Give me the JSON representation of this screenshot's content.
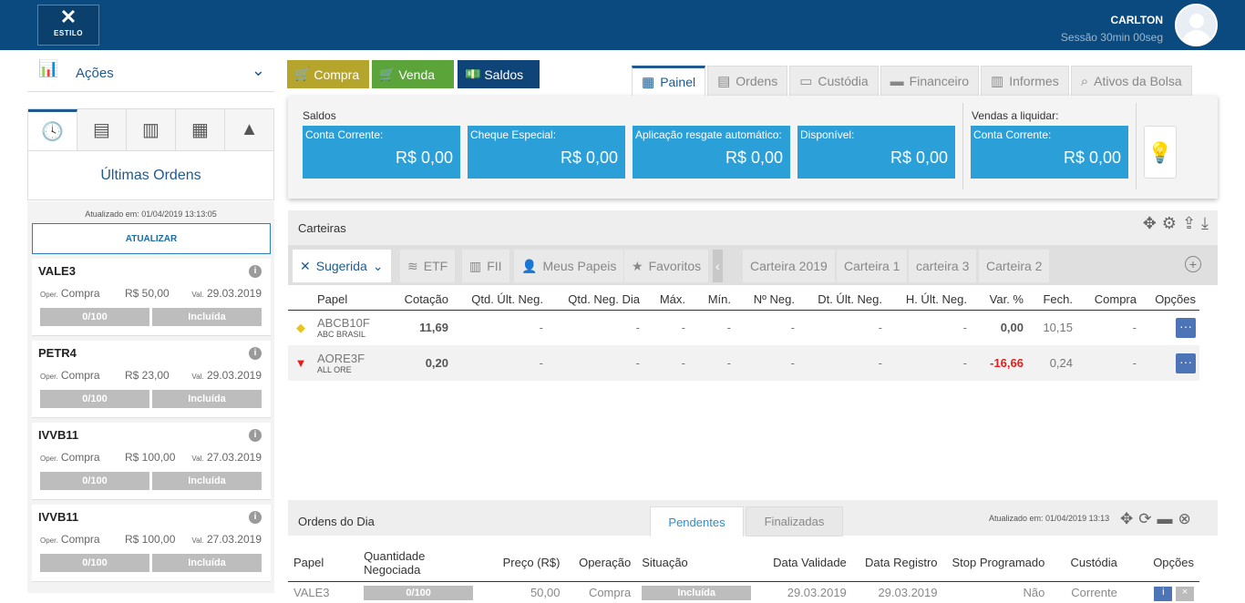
{
  "header": {
    "logo_text": "ESTILO",
    "user_name": "CARLTON",
    "session": "Sessão 30min 00seg"
  },
  "left": {
    "market_select": "Ações",
    "panel_title": "Últimas Ordens",
    "updated": "Atualizado em: 01/04/2019 13:13:05",
    "refresh_label": "ATUALIZAR",
    "orders": [
      {
        "ticker": "VALE3",
        "op_prefix": "Oper.",
        "op": "Compra",
        "price": "R$ 50,00",
        "val_prefix": "Val.",
        "val": "29.03.2019",
        "qty": "0/100",
        "status": "Incluída"
      },
      {
        "ticker": "PETR4",
        "op_prefix": "Oper.",
        "op": "Compra",
        "price": "R$ 23,00",
        "val_prefix": "Val.",
        "val": "29.03.2019",
        "qty": "0/100",
        "status": "Incluída"
      },
      {
        "ticker": "IVVB11",
        "op_prefix": "Oper.",
        "op": "Compra",
        "price": "R$ 100,00",
        "val_prefix": "Val.",
        "val": "27.03.2019",
        "qty": "0/100",
        "status": "Incluída"
      },
      {
        "ticker": "IVVB11",
        "op_prefix": "Oper.",
        "op": "Compra",
        "price": "R$ 100,00",
        "val_prefix": "Val.",
        "val": "27.03.2019",
        "qty": "0/100",
        "status": "Incluída"
      }
    ]
  },
  "actions": {
    "compra": "Compra",
    "venda": "Venda",
    "saldos": "Saldos"
  },
  "tabs": [
    "Painel",
    "Ordens",
    "Custódia",
    "Financeiro",
    "Informes",
    "Ativos da Bolsa"
  ],
  "saldos": {
    "title": "Saldos",
    "title2": "Vendas a liquidar:",
    "boxes": [
      {
        "label": "Conta Corrente:",
        "value": "R$ 0,00"
      },
      {
        "label": "Cheque Especial:",
        "value": "R$ 0,00"
      },
      {
        "label": "Aplicação resgate automático:",
        "value": "R$ 0,00"
      },
      {
        "label": "Disponível:",
        "value": "R$ 0,00"
      },
      {
        "label": "Conta Corrente:",
        "value": "R$ 0,00"
      }
    ]
  },
  "carteiras": {
    "title": "Carteiras",
    "tabs": [
      "Sugerida",
      "ETF",
      "FII",
      "Meus Papeis",
      "Favoritos",
      "Carteira 2019",
      "Carteira 1",
      "carteira 3",
      "Carteira 2"
    ],
    "columns": [
      "Papel",
      "Cotação",
      "Qtd. Últ. Neg.",
      "Qtd. Neg. Dia",
      "Máx.",
      "Mín.",
      "Nº Neg.",
      "Dt. Últ. Neg.",
      "H. Últ. Neg.",
      "Var. %",
      "Fech.",
      "Compra",
      "Opções"
    ],
    "rows": [
      {
        "ticker": "ABCB10F",
        "name": "ABC BRASIL",
        "cot": "11,69",
        "qul": "-",
        "qnd": "-",
        "max": "-",
        "min": "-",
        "nneg": "-",
        "dt": "-",
        "h": "-",
        "var": "0,00",
        "fech": "10,15",
        "compra": "-",
        "opts": "···",
        "trend_color": "#e8c51e"
      },
      {
        "ticker": "AORE3F",
        "name": "ALL ORE",
        "cot": "0,20",
        "qul": "-",
        "qnd": "-",
        "max": "-",
        "min": "-",
        "nneg": "-",
        "dt": "-",
        "h": "-",
        "var": "-16,66",
        "fech": "0,24",
        "compra": "-",
        "opts": "···",
        "trend_color": "#e02020"
      }
    ]
  },
  "ordens_dia": {
    "title": "Ordens do Dia",
    "tab_pend": "Pendentes",
    "tab_fin": "Finalizadas",
    "updated": "Atualizado em: 01/04/2019 13:13",
    "columns": [
      "Papel",
      "Quantidade Negociada",
      "Preço (R$)",
      "Operação",
      "Situação",
      "Data Validade",
      "Data Registro",
      "Stop Programado",
      "Custódia",
      "Opções"
    ],
    "row": {
      "papel": "VALE3",
      "qtd": "0/100",
      "preco": "50,00",
      "op": "Compra",
      "sit": "Incluída",
      "val": "29.03.2019",
      "reg": "29.03.2019",
      "stop": "Não",
      "cust": "Corrente"
    }
  }
}
